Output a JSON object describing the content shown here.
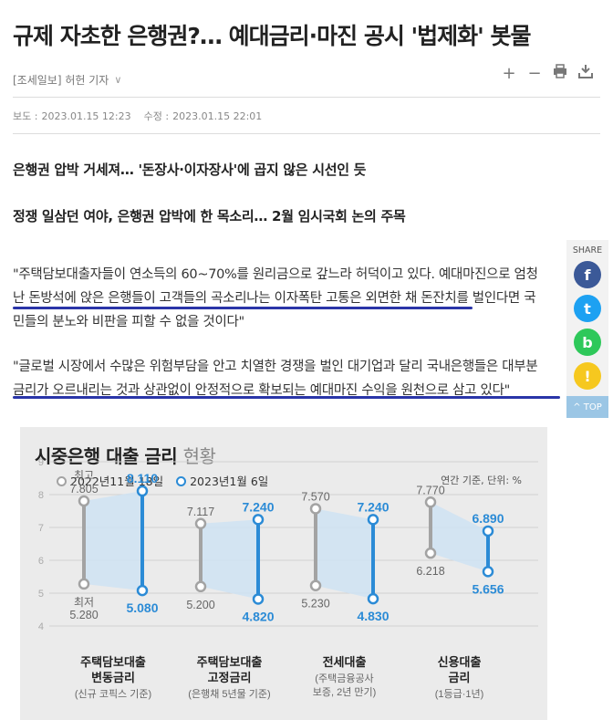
{
  "headline": "규제 자초한 은행권?… 예대금리·마진 공시 '법제화' 봇물",
  "byline": "[조세일보] 허헌 기자",
  "dates": {
    "published_label": "보도 :",
    "published": "2023.01.15 12:23",
    "modified_label": "수정 :",
    "modified": "2023.01.15 22:01"
  },
  "subheads": [
    "은행권 압박 거세져… '돈장사·이자장사'에 곱지 않은 시선인 듯",
    "정쟁 일삼던 여야, 은행권 압박에 한 목소리… 2월 임시국회 논의 주목"
  ],
  "quotes": [
    "\"주택담보대출자들이 연소득의 60~70%를 원리금으로 갚느라 허덕이고 있다. 예대마진으로 엄청난 돈방석에 앉은 은행들이 고객들의 곡소리나는 이자폭탄 고통은 외면한 채 돈잔치를 벌인다면 국민들의 분노와 비판을 피할 수 없을 것이다\"",
    "\"글로벌 시장에서 수많은 위험부담을 안고 치열한 경쟁을 벌인 대기업과 달리 국내은행들은 대부분 금리가 오르내리는 것과 상관없이 안정적으로 확보되는 예대마진 수익을 원천으로 삼고 있다\""
  ],
  "share": {
    "label": "SHARE",
    "buttons": [
      {
        "name": "facebook",
        "glyph": "f",
        "color": "#3b5998"
      },
      {
        "name": "twitter",
        "glyph": "t",
        "color": "#1da1f2"
      },
      {
        "name": "band",
        "glyph": "b",
        "color": "#2ec85a"
      },
      {
        "name": "kakaostory",
        "glyph": "!",
        "color": "#f6c81f"
      }
    ],
    "top_label": "^ TOP"
  },
  "chart_data": {
    "type": "range",
    "title": "시중은행 대출 금리",
    "title_suffix": "현황",
    "unit_note": "연간 기준, 단위: %",
    "ylim": [
      4,
      9
    ],
    "yticks": [
      "4",
      "5",
      "6",
      "7",
      "8",
      "9"
    ],
    "max_label": "최고",
    "min_label": "최저",
    "series": [
      {
        "name": "2022년11월 18일",
        "color": "#a3a3a3"
      },
      {
        "name": "2023년1월 6일",
        "color": "#2b8bd6"
      }
    ],
    "categories": [
      {
        "name": "주택담보대출\n변동금리",
        "sub": "(신규 코픽스 기준)",
        "old_max": 7.805,
        "old_min": 5.28,
        "new_max": 8.11,
        "new_min": 5.08,
        "old_max_label": "7.805",
        "old_min_label": "5.280",
        "new_max_label": "8.110",
        "new_min_label": "5.080"
      },
      {
        "name": "주택담보대출\n고정금리",
        "sub": "(은행채 5년물 기준)",
        "old_max": 7.117,
        "old_min": 5.2,
        "new_max": 7.24,
        "new_min": 4.82,
        "old_max_label": "7.117",
        "old_min_label": "5.200",
        "new_max_label": "7.240",
        "new_min_label": "4.820"
      },
      {
        "name": "전세대출",
        "sub": "(주택금융공사\n보증, 2년 만기)",
        "old_max": 7.57,
        "old_min": 5.23,
        "new_max": 7.24,
        "new_min": 4.83,
        "old_max_label": "7.570",
        "old_min_label": "5.230",
        "new_max_label": "7.240",
        "new_min_label": "4.830"
      },
      {
        "name": "신용대출\n금리",
        "sub": "(1등급·1년)",
        "old_max": 7.77,
        "old_min": 6.218,
        "new_max": 6.89,
        "new_min": 5.656,
        "old_max_label": "7.770",
        "old_min_label": "6.218",
        "new_max_label": "6.890",
        "new_min_label": "5.656"
      }
    ]
  }
}
